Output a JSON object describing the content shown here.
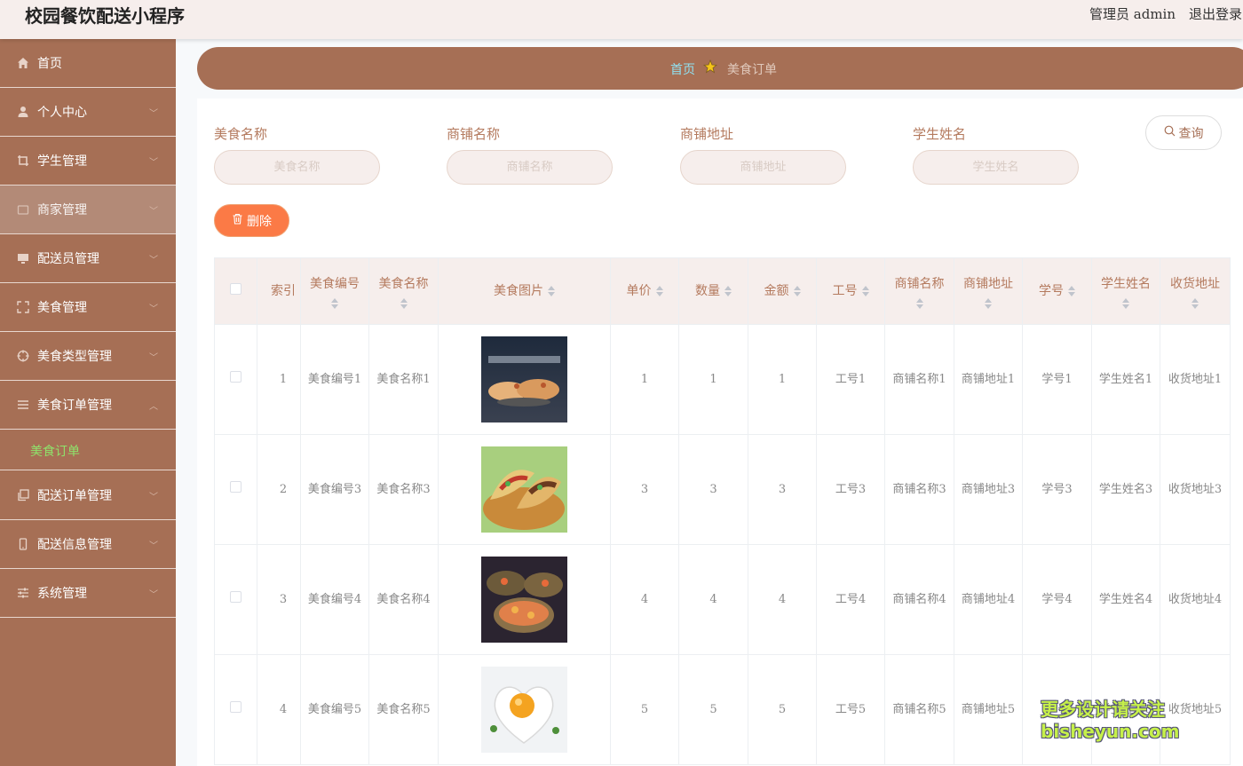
{
  "app": {
    "title": "校园餐饮配送小程序",
    "user": "管理员 admin",
    "logout": "退出登录"
  },
  "sidebar": {
    "items": [
      {
        "label": "首页",
        "icon": "home-icon"
      },
      {
        "label": "个人中心",
        "icon": "user-icon"
      },
      {
        "label": "学生管理",
        "icon": "crop-icon"
      },
      {
        "label": "商家管理",
        "icon": "store-icon"
      },
      {
        "label": "配送员管理",
        "icon": "monitor-icon"
      },
      {
        "label": "美食管理",
        "icon": "fullscreen-icon"
      },
      {
        "label": "美食类型管理",
        "icon": "target-icon"
      },
      {
        "label": "美食订单管理",
        "icon": "menu-icon"
      },
      {
        "label": "配送订单管理",
        "icon": "copy-icon"
      },
      {
        "label": "配送信息管理",
        "icon": "mobile-icon"
      },
      {
        "label": "系统管理",
        "icon": "sliders-icon"
      }
    ],
    "submenu": {
      "label": "美食订单"
    }
  },
  "breadcrumb": {
    "home": "首页",
    "current": "美食订单"
  },
  "filters": {
    "food_name": {
      "label": "美食名称",
      "placeholder": "美食名称"
    },
    "shop_name": {
      "label": "商铺名称",
      "placeholder": "商铺名称"
    },
    "shop_addr": {
      "label": "商铺地址",
      "placeholder": "商铺地址"
    },
    "student_name": {
      "label": "学生姓名",
      "placeholder": "学生姓名"
    },
    "search_label": "查询",
    "delete_label": "删除"
  },
  "table": {
    "headers": [
      "索引",
      "美食编号",
      "美食名称",
      "美食图片",
      "单价",
      "数量",
      "金额",
      "工号",
      "商铺名称",
      "商铺地址",
      "学号",
      "学生姓名",
      "收货地址"
    ],
    "rows": [
      {
        "index": "1",
        "food_no": "美食编号1",
        "food_name": "美食名称1",
        "image": "food-photo-dumplings",
        "price": "1",
        "qty": "1",
        "amount": "1",
        "staff_no": "工号1",
        "shop_name": "商铺名称1",
        "shop_addr": "商铺地址1",
        "student_no": "学号1",
        "student_name": "学生姓名1",
        "address": "收货地址1"
      },
      {
        "index": "2",
        "food_no": "美食编号3",
        "food_name": "美食名称3",
        "image": "food-photo-tacos",
        "price": "3",
        "qty": "3",
        "amount": "3",
        "staff_no": "工号3",
        "shop_name": "商铺名称3",
        "shop_addr": "商铺地址3",
        "student_no": "学号3",
        "student_name": "学生姓名3",
        "address": "收货地址3"
      },
      {
        "index": "3",
        "food_no": "美食编号4",
        "food_name": "美食名称4",
        "image": "food-photo-seafood",
        "price": "4",
        "qty": "4",
        "amount": "4",
        "staff_no": "工号4",
        "shop_name": "商铺名称4",
        "shop_addr": "商铺地址4",
        "student_no": "学号4",
        "student_name": "学生姓名4",
        "address": "收货地址4"
      },
      {
        "index": "4",
        "food_no": "美食编号5",
        "food_name": "美食名称5",
        "image": "food-photo-heart-egg",
        "price": "5",
        "qty": "5",
        "amount": "5",
        "staff_no": "工号5",
        "shop_name": "商铺名称5",
        "shop_addr": "商铺地址5",
        "student_no": "",
        "student_name": "学生姓名5",
        "address": "收货地址5"
      }
    ]
  },
  "watermark": {
    "line1": "更多设计请关注",
    "line2": "bisheyun.com"
  },
  "colors": {
    "brand": "#a66f55",
    "accent": "#fb7a46",
    "submenu_active": "#8fe36b",
    "header_bg": "#f6eeec"
  }
}
